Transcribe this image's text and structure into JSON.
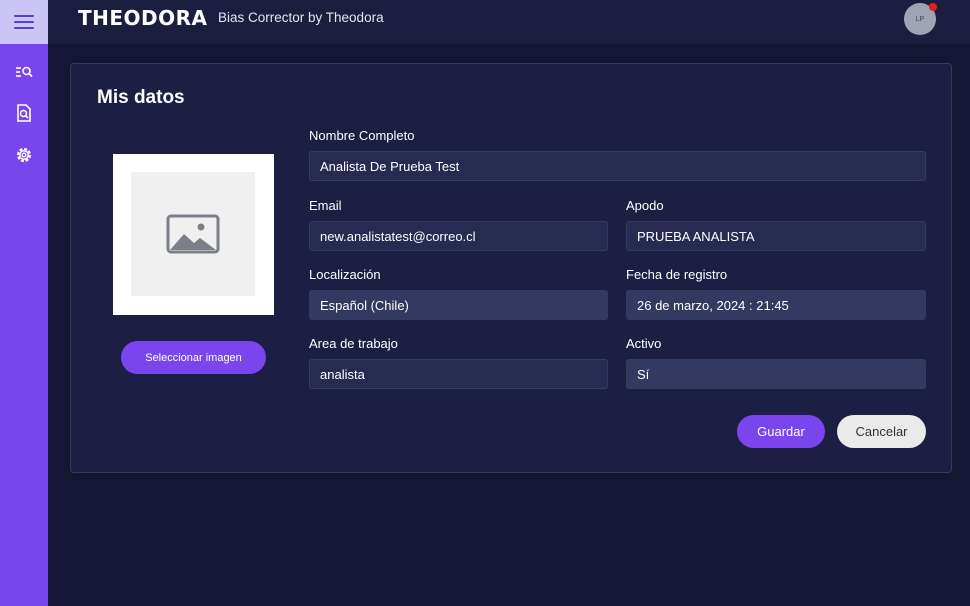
{
  "header": {
    "logo": "THEODORA",
    "subtitle": "Bias Corrector by Theodora",
    "avatar_initials": "LP"
  },
  "sidebar": {
    "items": [
      {
        "icon": "list-search-icon"
      },
      {
        "icon": "document-search-icon"
      },
      {
        "icon": "gear-icon"
      }
    ]
  },
  "profile": {
    "title": "Mis datos",
    "select_image_label": "Seleccionar imagen",
    "fields": {
      "nombre": {
        "label": "Nombre Completo",
        "value": "Analista De Prueba Test"
      },
      "email": {
        "label": "Email",
        "value": "new.analistatest@correo.cl"
      },
      "apodo": {
        "label": "Apodo",
        "value": "PRUEBA ANALISTA"
      },
      "localizacion": {
        "label": "Localización",
        "value": "Español (Chile)"
      },
      "fecha": {
        "label": "Fecha de registro",
        "value": "26 de marzo, 2024 : 21:45"
      },
      "area": {
        "label": "Area de trabajo",
        "value": "analista"
      },
      "activo": {
        "label": "Activo",
        "value": "Sí"
      }
    },
    "save_label": "Guardar",
    "cancel_label": "Cancelar"
  },
  "colors": {
    "accent": "#7b45ee",
    "background": "#151634",
    "card": "#1c1f43",
    "notification": "#e32020"
  }
}
